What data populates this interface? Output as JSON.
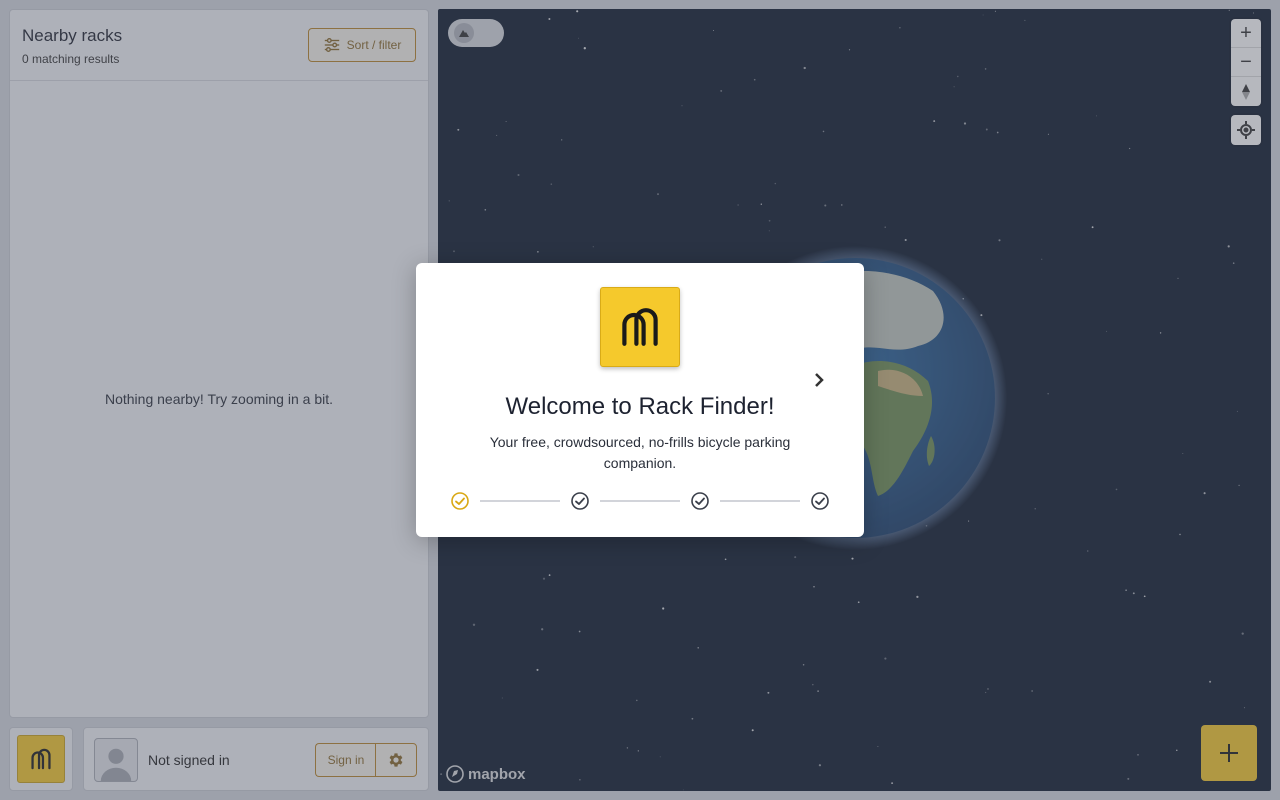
{
  "sidebar": {
    "title": "Nearby racks",
    "result_count": "0 matching results",
    "sort_filter_label": "Sort / filter",
    "empty_message": "Nothing nearby! Try zooming in a bit."
  },
  "account": {
    "status": "Not signed in",
    "sign_in_label": "Sign in"
  },
  "map": {
    "attribution": "mapbox",
    "zoom_in_label": "+",
    "zoom_out_label": "−"
  },
  "modal": {
    "title": "Welcome to Rack Finder!",
    "body": "Your free, crowdsourced, no-frills bicycle parking companion.",
    "steps": [
      {
        "icon": "check-circle-icon",
        "active": true
      },
      {
        "icon": "check-circle-icon",
        "active": false
      },
      {
        "icon": "check-circle-icon",
        "active": false
      },
      {
        "icon": "check-circle-icon",
        "active": false
      }
    ]
  },
  "colors": {
    "brand_yellow": "#f5c92c",
    "accent_brown": "#b9852a",
    "map_background": "#0f1b2e",
    "active_step": "#d9a814",
    "inactive_step": "#3a3f4a"
  },
  "icons": {
    "app_logo": "bike-rack-logo-icon",
    "sort": "sliders-icon",
    "settings": "gear-icon",
    "avatar": "user-silhouette-icon",
    "next": "chevron-right-icon",
    "geolocate": "crosshair-icon",
    "compass": "compass-icon",
    "map_style": "mountain-icon",
    "add": "plus-icon"
  }
}
